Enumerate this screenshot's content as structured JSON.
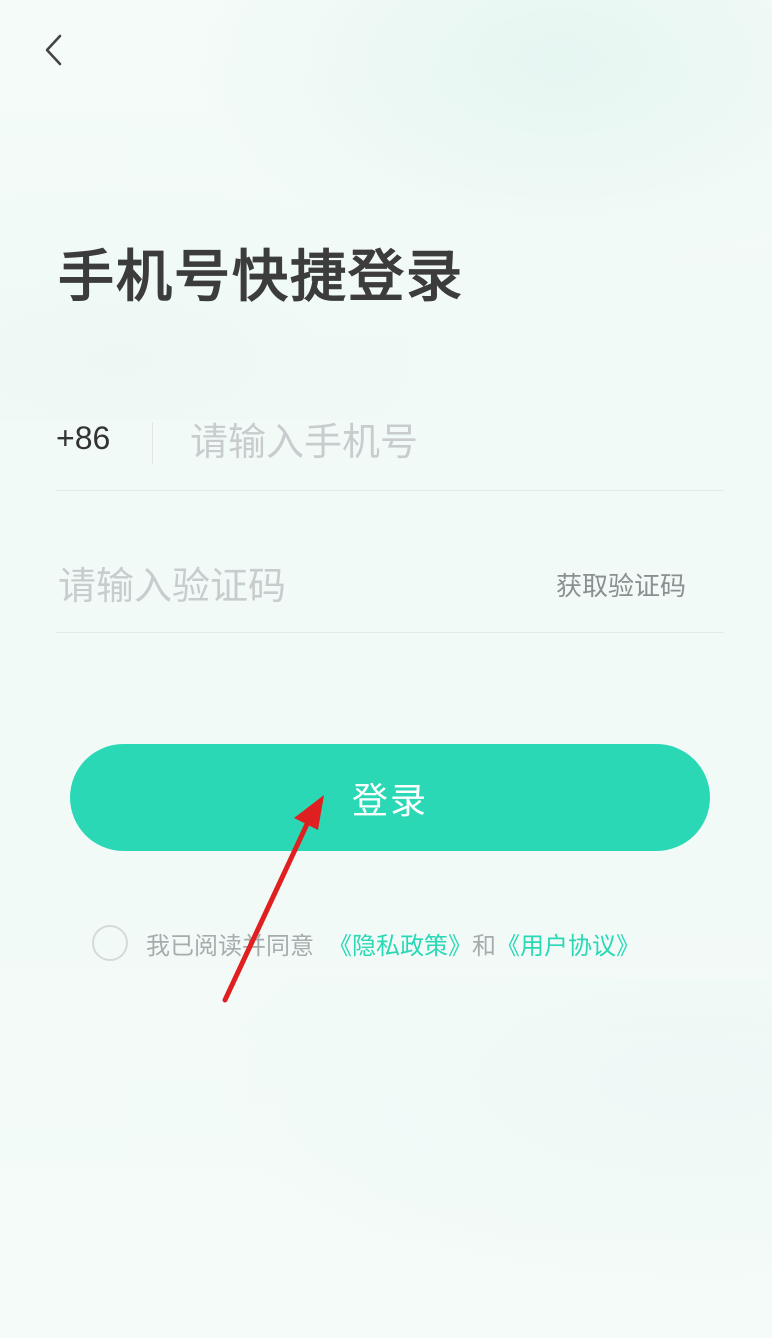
{
  "header": {
    "back_icon": "chevron-left-icon"
  },
  "title": "手机号快捷登录",
  "phone": {
    "country_code": "+86",
    "placeholder": "请输入手机号",
    "value": ""
  },
  "code": {
    "placeholder": "请输入验证码",
    "value": "",
    "get_code_label": "获取验证码"
  },
  "login_button": {
    "label": "登录"
  },
  "agreement": {
    "checked": false,
    "prefix": "我已阅读并同意",
    "privacy_link": "《隐私政策》",
    "and": "和",
    "terms_link": "《用户协议》"
  },
  "colors": {
    "accent": "#2ad8b5",
    "annotation_arrow": "#e02020"
  }
}
